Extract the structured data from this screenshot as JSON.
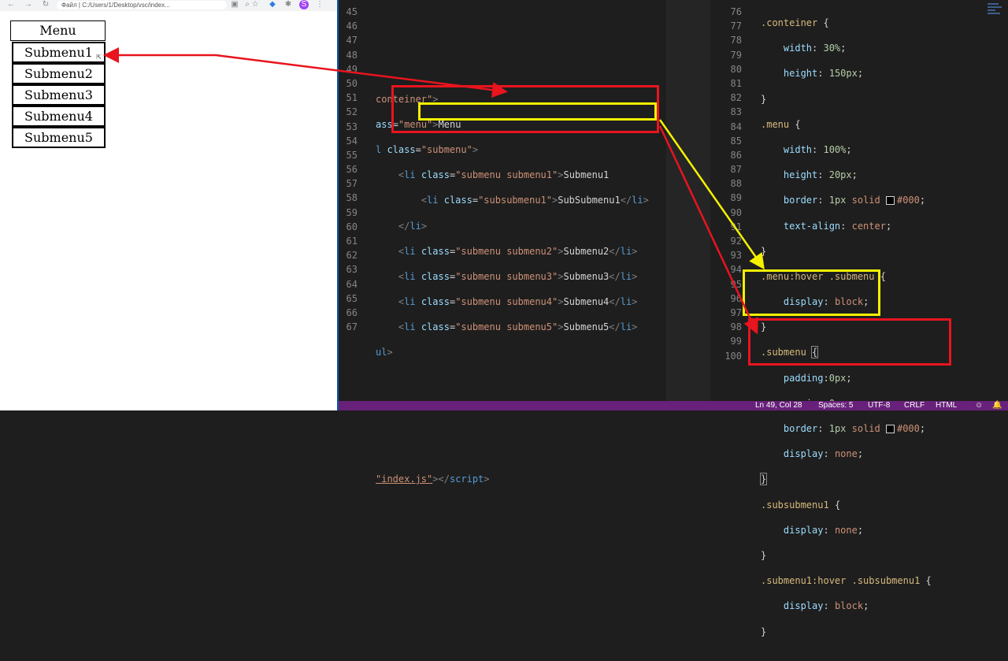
{
  "browser": {
    "address": "Файл | C:/Users/1/Desktop/vsc/index..."
  },
  "page": {
    "menu_label": "Menu",
    "submenus": [
      "Submenu1",
      "Submenu2",
      "Submenu3",
      "Submenu4",
      "Submenu5"
    ]
  },
  "html_editor": {
    "line_numbers": [
      "45",
      "46",
      "47",
      "48",
      "49",
      "50",
      "51",
      "52",
      "53",
      "54",
      "55",
      "56",
      "57",
      "58",
      "59",
      "60",
      "61",
      "62",
      "63",
      "64",
      "65",
      "66",
      "67"
    ]
  },
  "css_editor": {
    "line_numbers": [
      "76",
      "77",
      "78",
      "79",
      "80",
      "81",
      "82",
      "83",
      "84",
      "85",
      "86",
      "87",
      "88",
      "89",
      "90",
      "91",
      "92",
      "93",
      "94",
      "95",
      "96",
      "97",
      "98",
      "99",
      "100"
    ]
  },
  "statusbar": {
    "position": "Ln 49, Col 28",
    "spaces": "Spaces: 5",
    "encoding": "UTF-8",
    "eol": "CRLF",
    "language": "HTML"
  },
  "annotations": {
    "colors": {
      "red": "#e8141e",
      "yellow": "#f5f000"
    }
  }
}
